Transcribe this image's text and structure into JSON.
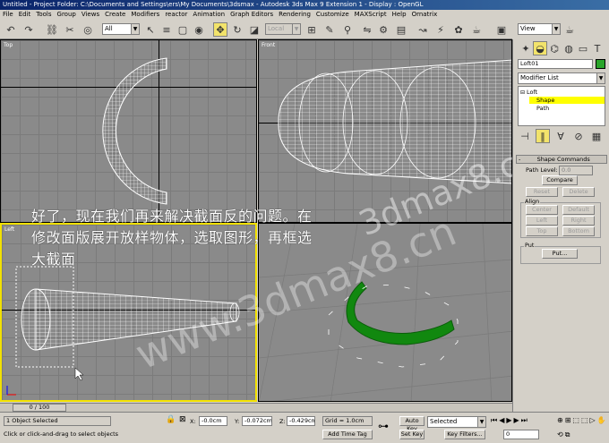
{
  "window": {
    "title": "Untitled   - Project Folder: C:\\Documents and Settings\\ers\\My Documents\\3dsmax   - Autodesk 3ds Max 9 Extension 1   - Display : OpenGL"
  },
  "menu": [
    "File",
    "Edit",
    "Tools",
    "Group",
    "Views",
    "Create",
    "Modifiers",
    "reactor",
    "Animation",
    "Graph Editors",
    "Rendering",
    "Customize",
    "MAXScript",
    "Help",
    "Ornatrix"
  ],
  "toolbar": {
    "selection_filter": "All",
    "ref_coord": "Local",
    "named_sel": "View"
  },
  "viewports": {
    "top": "Top",
    "front": "Front",
    "left": "Left",
    "persp": ""
  },
  "overlay": {
    "line1": "好了，现在我们再来解决截面反的问题。在",
    "line2": "修改面版展开放样物体，选取图形，再框选",
    "line3": "大截面",
    "watermark1": "3dmax8.cn",
    "watermark2": "www.3dmax8.cn"
  },
  "timeline": {
    "frame": "0 / 100"
  },
  "command_panel": {
    "object_name": "Loft01",
    "object_color": "#2aa52a",
    "modifier_list": "Modifier List",
    "stack": [
      "Loft",
      "Shape",
      "Path"
    ],
    "rollout_title": "Shape Commands",
    "path_level_label": "Path Level:",
    "path_level_value": "0.0",
    "compare": "Compare",
    "reset": "Reset",
    "delete": "Delete",
    "align_label": "Align",
    "center": "Center",
    "default": "Default",
    "left": "Left",
    "right": "Right",
    "top": "Top",
    "bottom": "Bottom",
    "put_label": "Put",
    "put_button": "Put..."
  },
  "status": {
    "selected": "1 Object Selected",
    "prompt": "Click or click-and-drag to select objects",
    "x_label": "X:",
    "x_value": "-0.0cm",
    "y_label": "Y:",
    "y_value": "-0.072cm",
    "z_label": "Z:",
    "z_value": "-0.429cm",
    "grid": "Grid = 1.0cm",
    "add_time_tag": "Add Time Tag",
    "auto_key": "Auto Key",
    "set_key": "Set Key",
    "key_mode": "Selected",
    "key_filters": "Key Filters...",
    "frame_field": "0"
  },
  "colors": {
    "active_viewport": "#f2e100",
    "loft_object": "#11880f",
    "highlight": "#ffff00"
  }
}
